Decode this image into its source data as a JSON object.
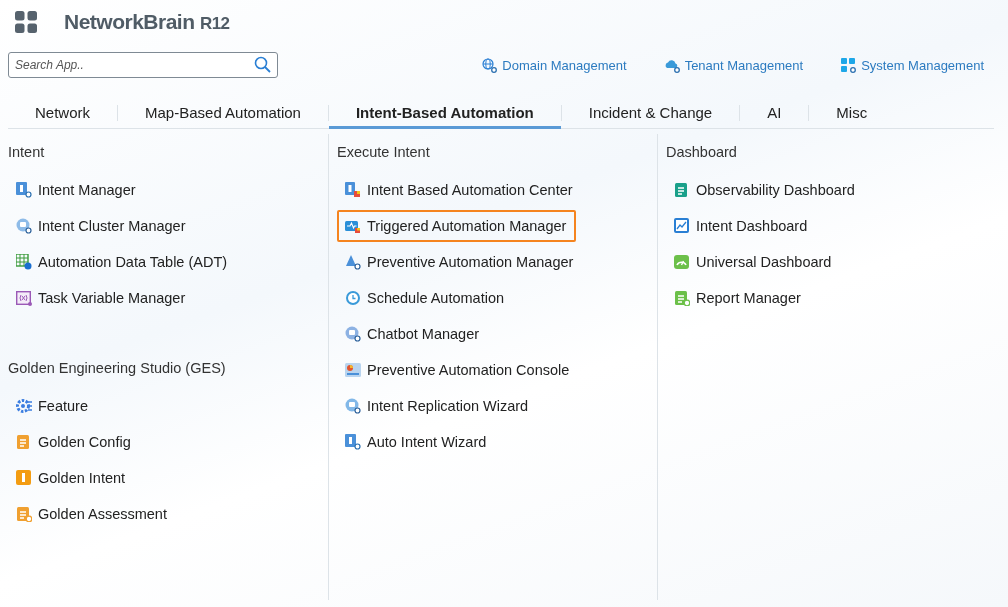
{
  "header": {
    "logo": "NetworkBrain",
    "version": "R12"
  },
  "search": {
    "placeholder": "Search App.."
  },
  "links": [
    "Domain Management",
    "Tenant Management",
    "System Management"
  ],
  "tabs": [
    {
      "label": "Network",
      "selected": false
    },
    {
      "label": "Map-Based Automation",
      "selected": false
    },
    {
      "label": "Intent-Based Automation",
      "selected": true
    },
    {
      "label": "Incident & Change",
      "selected": false
    },
    {
      "label": "AI",
      "selected": false
    },
    {
      "label": "Misc",
      "selected": false
    }
  ],
  "columns": [
    {
      "sections": [
        {
          "title": "Intent",
          "items": [
            {
              "label": "Intent Manager",
              "highlighted": false
            },
            {
              "label": "Intent Cluster Manager",
              "highlighted": false
            },
            {
              "label": "Automation Data Table (ADT)",
              "highlighted": false
            },
            {
              "label": "Task Variable Manager",
              "highlighted": false
            }
          ]
        },
        {
          "title": "Golden Engineering Studio (GES)",
          "items": [
            {
              "label": "Feature",
              "highlighted": false
            },
            {
              "label": "Golden Config",
              "highlighted": false
            },
            {
              "label": "Golden Intent",
              "highlighted": false
            },
            {
              "label": "Golden Assessment",
              "highlighted": false
            }
          ]
        }
      ]
    },
    {
      "sections": [
        {
          "title": "Execute Intent",
          "items": [
            {
              "label": "Intent Based Automation Center",
              "highlighted": false
            },
            {
              "label": "Triggered Automation Manager",
              "highlighted": true
            },
            {
              "label": "Preventive Automation Manager",
              "highlighted": false
            },
            {
              "label": "Schedule Automation",
              "highlighted": false
            },
            {
              "label": "Chatbot Manager",
              "highlighted": false
            },
            {
              "label": "Preventive Automation Console",
              "highlighted": false
            },
            {
              "label": "Intent Replication Wizard",
              "highlighted": false
            },
            {
              "label": "Auto Intent Wizard",
              "highlighted": false
            }
          ]
        }
      ]
    },
    {
      "sections": [
        {
          "title": "Dashboard",
          "items": [
            {
              "label": "Observability Dashboard",
              "highlighted": false
            },
            {
              "label": "Intent Dashboard",
              "highlighted": false
            },
            {
              "label": "Universal Dashboard",
              "highlighted": false
            },
            {
              "label": "Report Manager",
              "highlighted": false
            }
          ]
        }
      ]
    }
  ]
}
